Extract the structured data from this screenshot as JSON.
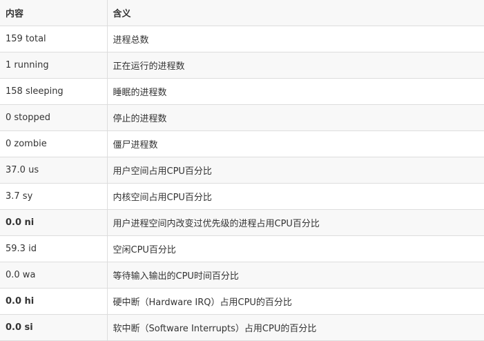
{
  "header": {
    "col1": "内容",
    "col2": "含义"
  },
  "rows": [
    {
      "item": "159 total",
      "meaning": "进程总数",
      "bold": false
    },
    {
      "item": "1 running",
      "meaning": "正在运行的进程数",
      "bold": false
    },
    {
      "item": "158 sleeping",
      "meaning": "睡眠的进程数",
      "bold": false
    },
    {
      "item": "0 stopped",
      "meaning": "停止的进程数",
      "bold": false
    },
    {
      "item": "0 zombie",
      "meaning": "僵尸进程数",
      "bold": false
    },
    {
      "item": "37.0 us",
      "meaning": "用户空间占用CPU百分比",
      "bold": false
    },
    {
      "item": "3.7 sy",
      "meaning": "内核空间占用CPU百分比",
      "bold": false
    },
    {
      "item": "0.0 ni",
      "meaning": "用户进程空间内改变过优先级的进程占用CPU百分比",
      "bold": true
    },
    {
      "item": "59.3 id",
      "meaning": "空闲CPU百分比",
      "bold": false
    },
    {
      "item": "0.0 wa",
      "meaning": "等待输入输出的CPU时间百分比",
      "bold": false
    },
    {
      "item": "0.0 hi",
      "meaning": "硬中断（Hardware IRQ）占用CPU的百分比",
      "bold": true
    },
    {
      "item": "0.0 si",
      "meaning": "软中断（Software Interrupts）占用CPU的百分比",
      "bold": true
    }
  ]
}
